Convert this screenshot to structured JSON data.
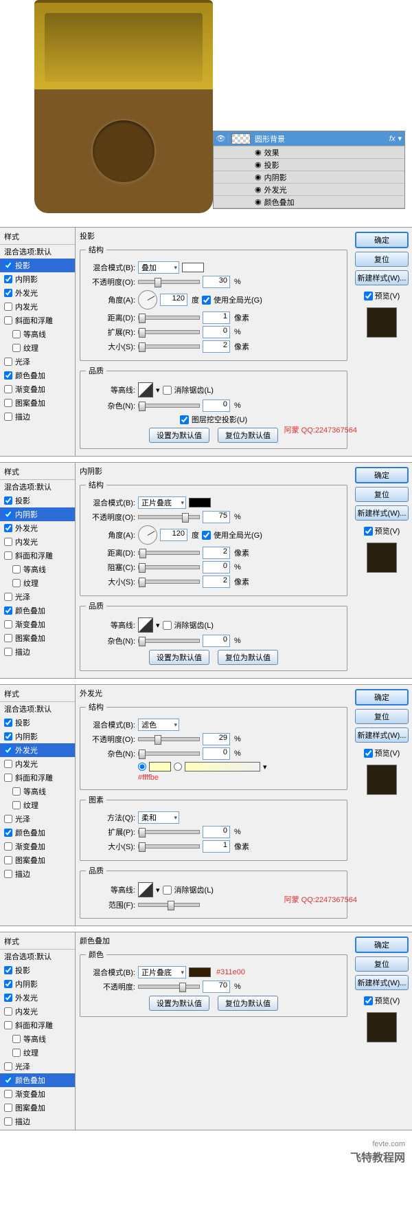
{
  "layers": {
    "layer_name": "圆形背景",
    "fx": "fx",
    "effects": "效果",
    "items": [
      "投影",
      "内阴影",
      "外发光",
      "颜色叠加"
    ]
  },
  "styles": {
    "heading": "样式",
    "default": "混合选项:默认",
    "list": [
      {
        "key": "投影",
        "drop": true,
        "inner": true,
        "outer": true,
        "color": true
      },
      {
        "key": "内阴影",
        "drop": true,
        "inner": true,
        "outer": true,
        "color": true
      },
      {
        "key": "外发光",
        "drop": true,
        "inner": true,
        "outer": true,
        "color": true
      },
      {
        "key": "内发光"
      },
      {
        "key": "斜面和浮雕"
      },
      {
        "key": "等高线",
        "indent": true
      },
      {
        "key": "纹理",
        "indent": true
      },
      {
        "key": "光泽"
      },
      {
        "key": "颜色叠加",
        "drop": true,
        "inner": true,
        "outer": true,
        "color": true
      },
      {
        "key": "渐变叠加"
      },
      {
        "key": "图案叠加"
      },
      {
        "key": "描边"
      }
    ]
  },
  "right": {
    "ok": "确定",
    "reset": "复位",
    "new_style": "新建样式(W)...",
    "preview": "预览(V)"
  },
  "lbls": {
    "blend": "混合模式(B):",
    "opacity": "不透明度(O):",
    "opacity_y": "不透明度:",
    "angle": "角度(A):",
    "distance": "距离(D):",
    "spread": "扩展(R):",
    "choke": "阻塞(C):",
    "size": "大小(S):",
    "contour": "等高线:",
    "noise": "杂色(N):",
    "anti": "消除锯齿(L)",
    "knock": "图层挖空投影(U)",
    "global": "使用全局光(G)",
    "deg": "度",
    "pct": "%",
    "px": "像素",
    "struct": "结构",
    "quality": "品质",
    "elements": "图素",
    "color": "颜色",
    "method": "方法(Q):",
    "spread2": "扩展(P):",
    "range": "范围(F):",
    "set_def": "设置为默认值",
    "reset_def": "复位为默认值"
  },
  "panel1": {
    "title": "投影",
    "blend_mode": "叠加",
    "opacity": "30",
    "angle": "120",
    "distance": "1",
    "spread": "0",
    "size": "2",
    "noise": "0",
    "watermark": "阿蒙 QQ:2247367564"
  },
  "panel2": {
    "title": "内阴影",
    "blend_mode": "正片叠底",
    "opacity": "75",
    "angle": "120",
    "distance": "2",
    "choke": "0",
    "size": "2",
    "noise": "0"
  },
  "panel3": {
    "title": "外发光",
    "blend_mode": "滤色",
    "opacity": "29",
    "noise": "0",
    "color_hex": "#ffffbe",
    "method": "柔和",
    "spread": "0",
    "size": "1",
    "watermark": "阿蒙 QQ:2247367564"
  },
  "panel4": {
    "title": "颜色叠加",
    "blend_mode": "正片叠底",
    "opacity": "70",
    "color_hex": "#311e00"
  },
  "footer": {
    "site": "fevte.com",
    "brand": "飞特教程网"
  }
}
